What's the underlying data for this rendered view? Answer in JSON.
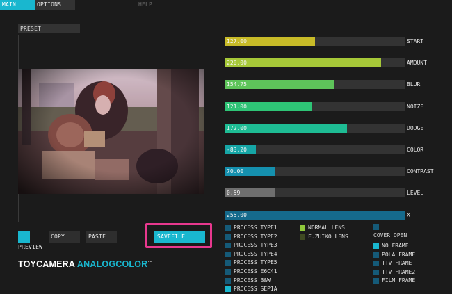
{
  "menu": {
    "main": "MAIN",
    "options": "OPTIONS",
    "help": "HELP"
  },
  "preset": {
    "label": "PRESET"
  },
  "preview": {
    "label": "PREVIEW"
  },
  "buttons": {
    "copy": "COPY",
    "paste": "PASTE",
    "savefile": "SAVEFILE"
  },
  "logo": {
    "part1": "TOYCAMERA",
    "part2": "ANALOGCOLOR",
    "tm": "™"
  },
  "sliders": [
    {
      "label": "START",
      "value": "127.00",
      "fill": 0.5,
      "color": "#c8bb28"
    },
    {
      "label": "AMOUNT",
      "value": "220.00",
      "fill": 0.87,
      "color": "#a6c838"
    },
    {
      "label": "BLUR",
      "value": "154.75",
      "fill": 0.61,
      "color": "#5ec45a"
    },
    {
      "label": "NOIZE",
      "value": "121.00",
      "fill": 0.48,
      "color": "#2ec476"
    },
    {
      "label": "DODGE",
      "value": "172.00",
      "fill": 0.68,
      "color": "#1ebc94"
    },
    {
      "label": "COLOR",
      "value": "-83.20",
      "fill": 0.17,
      "color": "#16a6a6"
    },
    {
      "label": "CONTRAST",
      "value": "70.00",
      "fill": 0.28,
      "color": "#1590ae"
    },
    {
      "label": "LEVEL",
      "value": "0.59",
      "fill": 0.28,
      "color": "#6e6e6e"
    },
    {
      "label": "X",
      "value": "255.00",
      "fill": 1.0,
      "color": "#156a8c"
    }
  ],
  "process_types": [
    {
      "label": "PROCESS TYPE1",
      "active": false
    },
    {
      "label": "PROCESS TYPE2",
      "active": false
    },
    {
      "label": "PROCESS TYPE3",
      "active": false
    },
    {
      "label": "PROCESS TYPE4",
      "active": false
    },
    {
      "label": "PROCESS TYPE5",
      "active": false
    },
    {
      "label": "PROCESS E6C41",
      "active": false
    },
    {
      "label": "PROCESS B&W",
      "active": false
    },
    {
      "label": "PROCESS SEPIA",
      "active": true
    }
  ],
  "lenses": [
    {
      "label": "NORMAL LENS",
      "active": true
    },
    {
      "label": "F.ZUIKO LENS",
      "active": false
    }
  ],
  "cover": {
    "label": "COVER OPEN",
    "active": false
  },
  "frames": [
    {
      "label": "NO FRAME",
      "active": true
    },
    {
      "label": "POLA FRAME",
      "active": false
    },
    {
      "label": "TTV FRAME",
      "active": false
    },
    {
      "label": "TTV FRAME2",
      "active": false
    },
    {
      "label": "FILM FRAME",
      "active": false
    }
  ],
  "colors": {
    "accent": "#19b7cf",
    "highlight": "#e8388e",
    "inactive_box": "#155a78",
    "lens_active": "#8fc83a",
    "lens_inactive": "#3f4a22"
  }
}
